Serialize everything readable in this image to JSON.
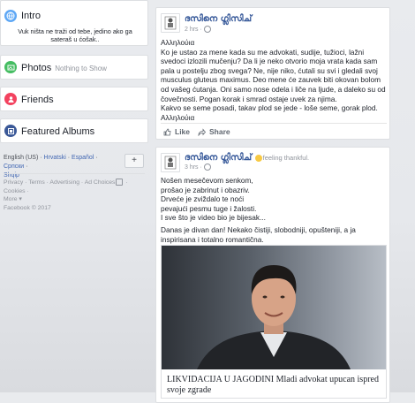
{
  "intro": {
    "title": "Intro",
    "bio": "Vuk ništa ne traži od tebe, jedino ako ga sateraš u ćošak.."
  },
  "photos": {
    "title": "Photos",
    "sub": "Nothing to Show"
  },
  "friends": {
    "title": "Friends"
  },
  "albums": {
    "title": "Featured Albums"
  },
  "languages": {
    "items": [
      "English (US)",
      "Hrvatski",
      "Español",
      "Српски",
      "Shqip"
    ],
    "add": "+"
  },
  "footer": {
    "links": [
      "Privacy",
      "Terms",
      "Advertising",
      "Ad Choices",
      "Cookies",
      "More"
    ],
    "copyright": "Facebook © 2017"
  },
  "post1": {
    "author": "ദസിനെ ഗ്ലിസിച്",
    "time": "2 hrs",
    "paragraphs": [
      "Αλληλούια",
      "Ko je ustao za mene kada su me advokati, sudije, tužioci, lažni svedoci izlozili mučenju? Da li je neko otvorio moja vrata kada sam pala u postelju zbog svega? Ne, nije niko, ćutali su svi i gledali svoj musculus gluteus maximus. Deo mene će zauvek biti okovan bolom od vašeg ćutanja. Oni samo nose odela i liče na ljude, a daleko su od čovečnosti. Pogan korak i smrad ostaje uvek za njima.",
      "Kakvo se seme posadi, takav plod se jede - loše seme, gorak plod. Αλληλούια"
    ],
    "like": "Like",
    "share": "Share"
  },
  "post2": {
    "author": "ദസിനെ ഗ്ലിസിച്",
    "feeling": "feeling thankful.",
    "time": "3 hrs",
    "lines": [
      "Nošen mesečevom senkom,",
      "prošao je zabrinut i obazriv.",
      "Drveće je zviždalo te noći",
      "pevajući pesmu tuge i žalosti.",
      "I sve što je video bio je bijesak..."
    ],
    "paragraph2": "Danas je divan dan! Nekako čistiji, slobodniji, opušteniji, a ja inspirisana i totalno romantična.",
    "link_title": "LIKVIDACIJA U JAGODINI Mladi advokat upucan ispred svoje zgrade"
  },
  "colors": {
    "link": "#4267b2",
    "muted": "#90949c",
    "intro_icon": "#5fa8f5",
    "photos_icon": "#45bd62",
    "friends_icon": "#f3425f",
    "albums_icon": "#3b5998"
  }
}
